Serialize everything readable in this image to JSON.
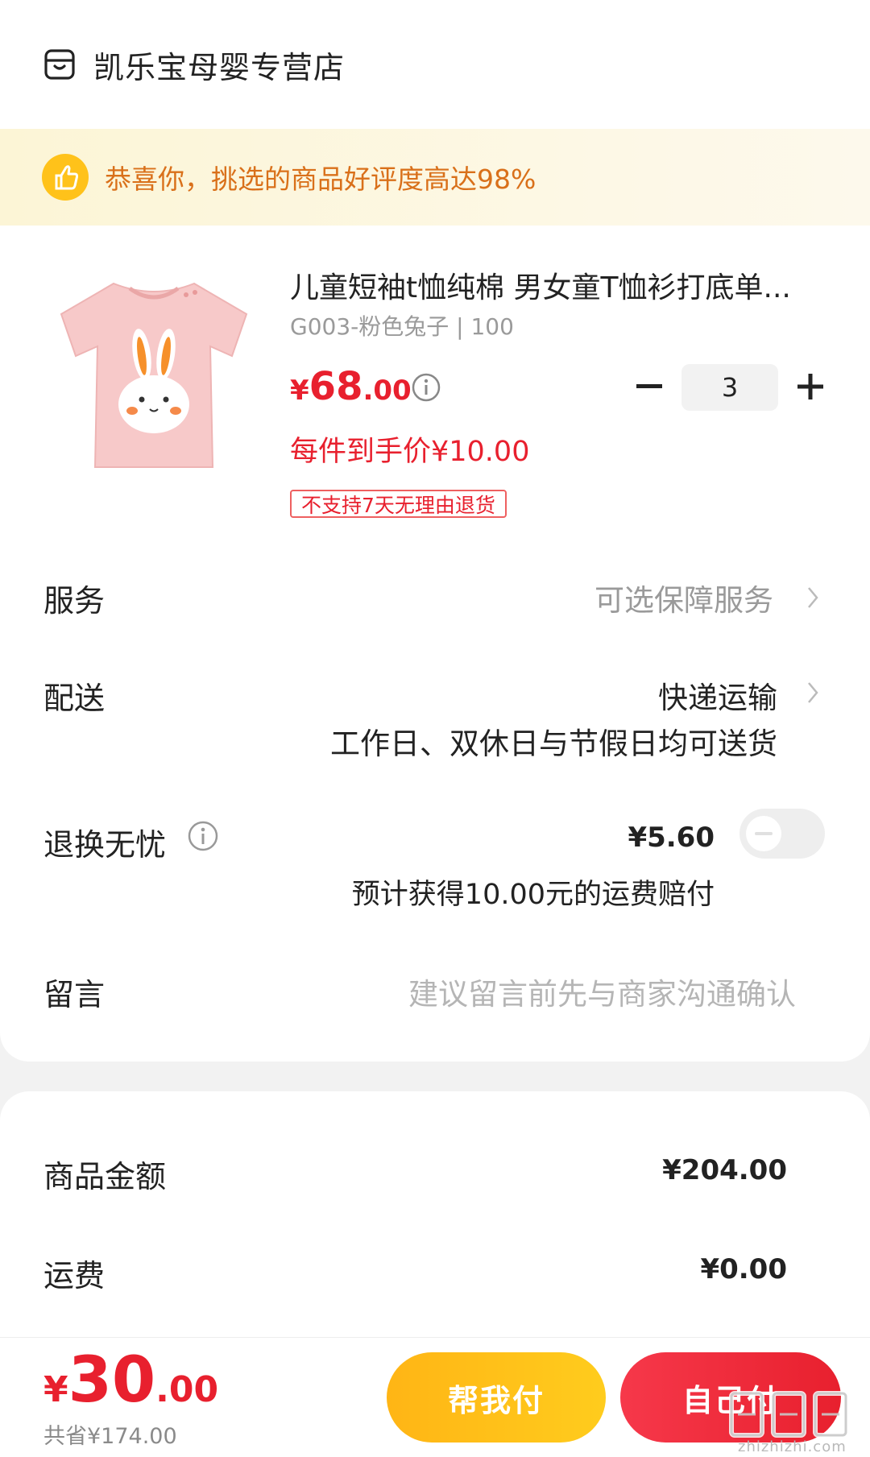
{
  "shop": {
    "name": "凯乐宝母婴专营店"
  },
  "banner": {
    "text": "恭喜你，挑选的商品好评度高达98%"
  },
  "product": {
    "title": "儿童短袖t恤纯棉 男女童T恤衫打底单...",
    "spec": "G003-粉色兔子 | 100",
    "price_symbol": "¥",
    "price_int": "68",
    "price_dec": ".00",
    "final_price": "每件到手价¥10.00",
    "tag": "不支持7天无理由退货",
    "quantity": "3"
  },
  "rows": {
    "service": {
      "label": "服务",
      "value": "可选保障服务"
    },
    "delivery": {
      "label": "配送",
      "value": "快递运输",
      "subtext": "工作日、双休日与节假日均可送货"
    },
    "return": {
      "label": "退换无忧",
      "price": "¥5.60",
      "subtext": "预计获得10.00元的运费赔付",
      "enabled": false
    },
    "message": {
      "label": "留言",
      "placeholder": "建议留言前先与商家沟通确认"
    }
  },
  "summary": {
    "goods_label": "商品金额",
    "goods_value": "¥204.00",
    "shipping_label": "运费",
    "shipping_value": "¥0.00"
  },
  "bottom": {
    "total_symbol": "¥",
    "total_int": "30",
    "total_dec": ".00",
    "saved": "共省¥174.00",
    "help_pay": "帮我付",
    "self_pay": "自己付"
  },
  "watermark": {
    "text": "zhizhizhi.com"
  },
  "colors": {
    "accent_red": "#e8202e",
    "banner_orange": "#d9701a",
    "help_yellow": "#ffc21a"
  }
}
